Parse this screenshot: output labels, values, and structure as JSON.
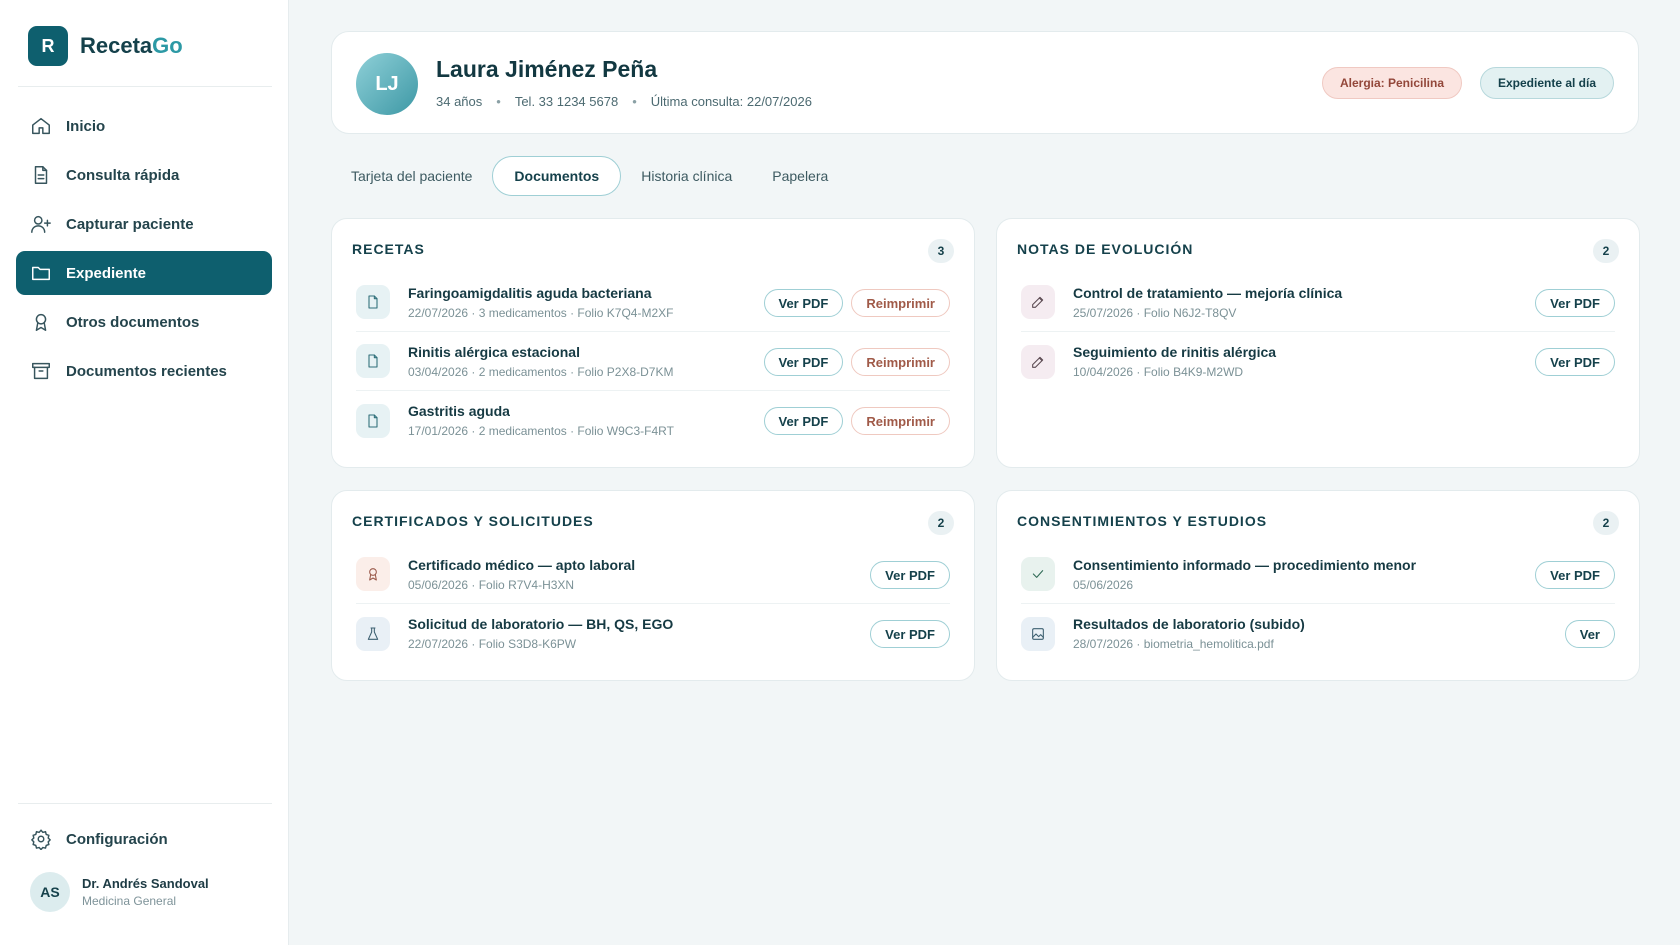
{
  "brand": {
    "mark": "R",
    "name_part1": "Receta",
    "name_part2": "Go"
  },
  "sidebar": {
    "items": [
      {
        "label": "Inicio",
        "icon": "home-icon"
      },
      {
        "label": "Consulta rápida",
        "icon": "document-icon"
      },
      {
        "label": "Capturar paciente",
        "icon": "user-plus-icon"
      },
      {
        "label": "Expediente",
        "icon": "folder-icon",
        "active": true
      },
      {
        "label": "Otros documentos",
        "icon": "award-icon"
      },
      {
        "label": "Documentos recientes",
        "icon": "archive-icon"
      }
    ],
    "settings_label": "Configuración",
    "user": {
      "initials": "AS",
      "name": "Dr. Andrés Sandoval",
      "role": "Medicina General"
    }
  },
  "patient": {
    "initials": "LJ",
    "name": "Laura Jiménez Peña",
    "age": "34 años",
    "phone": "Tel. 33 1234 5678",
    "last_visit": "Última consulta: 22/07/2026",
    "allergy_badge": "Alergia: Penicilina",
    "status_badge": "Expediente al día"
  },
  "tabs": [
    {
      "label": "Tarjeta del paciente"
    },
    {
      "label": "Documentos",
      "active": true
    },
    {
      "label": "Historia clínica"
    },
    {
      "label": "Papelera"
    }
  ],
  "sections": {
    "recetas": {
      "title": "RECETAS",
      "count": "3",
      "items": [
        {
          "title": "Faringoamigdalitis aguda bacteriana",
          "sub": "22/07/2026 · 3 medicamentos · Folio K7Q4-M2XF",
          "btn1": "Ver PDF",
          "btn2": "Reimprimir"
        },
        {
          "title": "Rinitis alérgica estacional",
          "sub": "03/04/2026 · 2 medicamentos · Folio P2X8-D7KM",
          "btn1": "Ver PDF",
          "btn2": "Reimprimir"
        },
        {
          "title": "Gastritis aguda",
          "sub": "17/01/2026 · 2 medicamentos · Folio W9C3-F4RT",
          "btn1": "Ver PDF",
          "btn2": "Reimprimir"
        }
      ]
    },
    "notas": {
      "title": "NOTAS DE EVOLUCIÓN",
      "count": "2",
      "items": [
        {
          "title": "Control de tratamiento — mejoría clínica",
          "sub": "25/07/2026 · Folio N6J2-T8QV",
          "btn1": "Ver PDF"
        },
        {
          "title": "Seguimiento de rinitis alérgica",
          "sub": "10/04/2026 · Folio B4K9-M2WD",
          "btn1": "Ver PDF"
        }
      ]
    },
    "certificados": {
      "title": "CERTIFICADOS Y SOLICITUDES",
      "count": "2",
      "items": [
        {
          "title": "Certificado médico — apto laboral",
          "sub": "05/06/2026 · Folio R7V4-H3XN",
          "btn1": "Ver PDF"
        },
        {
          "title": "Solicitud de laboratorio — BH, QS, EGO",
          "sub": "22/07/2026 · Folio S3D8-K6PW",
          "btn1": "Ver PDF"
        }
      ]
    },
    "consentimientos": {
      "title": "CONSENTIMIENTOS Y ESTUDIOS",
      "count": "2",
      "items": [
        {
          "title": "Consentimiento informado — procedimiento menor",
          "sub": "05/06/2026",
          "btn1": "Ver PDF"
        },
        {
          "title": "Resultados de laboratorio (subido)",
          "sub": "28/07/2026 · biometria_hemolitica.pdf",
          "btn1": "Ver"
        }
      ]
    }
  }
}
